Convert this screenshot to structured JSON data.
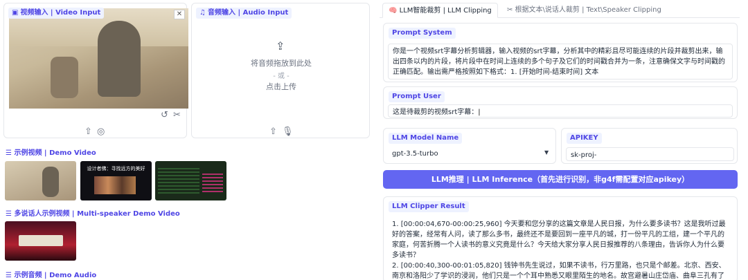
{
  "video_panel": {
    "label": "视频输入 | Video Input",
    "close": "✕"
  },
  "audio_panel": {
    "label": "音频输入 | Audio Input",
    "upload_hint": "将音频拖放到此处",
    "or": "- 或 -",
    "click_upload": "点击上传"
  },
  "demo_video": {
    "label": "示例视频 | Demo Video",
    "thumb2_title": "设计者佛：寻找远方的美好"
  },
  "multi_speaker": {
    "label": "多说话人示例视频 | Multi-speaker Demo Video"
  },
  "demo_audio": {
    "label": "示例音频 | Demo Audio"
  },
  "tabs": [
    "LLM智能裁剪 | LLM Clipping",
    "根据文本\\说话人裁剪 | Text\\Speaker Clipping"
  ],
  "prompt_system": {
    "label": "Prompt System",
    "value": "你是一个视频srt字幕分析剪辑器，输入视频的srt字幕，分析其中的精彩且尽可能连续的片段并裁剪出来，输出四条以内的片段，将片段中在时间上连续的多个句子及它们的时间戳合并为一条，注意确保文字与时间戳的正确匹配。输出需严格按照如下格式：1. [开始时间-结束时间] 文本"
  },
  "prompt_user": {
    "label": "Prompt User",
    "value": "这是待裁剪的视频srt字幕："
  },
  "llm_model": {
    "label": "LLM Model Name",
    "value": "gpt-3.5-turbo"
  },
  "apikey": {
    "label": "APIKEY",
    "value": "sk-proj-"
  },
  "inference_button": "LLM推理 | LLM Inference（首先进行识别，非g4f需配置对应apikey）",
  "result": {
    "label": "LLM Clipper Result",
    "value": "1. [00:00:04,670-00:00:25,960] 今天要和您分享的这篇文章是人民日报，为什么要多读书？这是我听过最好的答案，经常有人问，读了那么多书，最终还不是要回到一座平凡的城，打一份平凡的工组，建一个平凡的家庭，何苦折腾一个人读书的意义究竟是什么？今天给大家分享人民日报推荐的八条理由，告诉你人为什么要多读书？\n2. [00:00:40,300-00:01:05,820] 钱钟书先生说过，如果不读书，行万里路，也只是个邮差。北京、西安、南京和洛阳少了学识的浸润，他们只是一个个耳中熟悉又眼里陌生的地名。故宫避暑山庄岱庙、曲阜三孔有了文化的熏陶，"
  }
}
